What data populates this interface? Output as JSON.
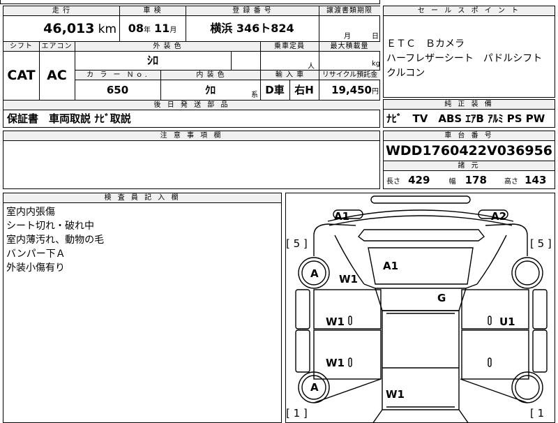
{
  "top_strip": {
    "partial_left": "",
    "partial_mid": ""
  },
  "mileage": {
    "header": "走 行",
    "value": "46,013",
    "unit": "km"
  },
  "inspection": {
    "header": "車 検",
    "year": "08",
    "year_unit": "年",
    "month": "11",
    "month_unit": "月"
  },
  "registration": {
    "header": "登 録 番 号",
    "value": "横浜 346ト824"
  },
  "transfer_deadline": {
    "header": "譲渡書類期限",
    "month_unit": "月",
    "day_unit": "日"
  },
  "shift": {
    "header": "シフト",
    "value": "CAT"
  },
  "aircon": {
    "header": "エアコン",
    "value": "AC"
  },
  "exterior_color": {
    "header": "外 装 色",
    "value": "ｼﾛ"
  },
  "capacity": {
    "header": "乗車定員",
    "unit": "人"
  },
  "max_load": {
    "header": "最大積載量",
    "unit": "kg"
  },
  "color_no": {
    "header": "カ ラ ー Ｎｏ.",
    "value": "650"
  },
  "interior_color": {
    "header": "内 装 色",
    "value": "ｸﾛ",
    "suffix": "系"
  },
  "import": {
    "header": "輸 入 車",
    "value1": "D車",
    "value2": "右H"
  },
  "recycle": {
    "header": "リサイクル預託金",
    "value": "19,450",
    "unit": "円"
  },
  "later_parts": {
    "header": "後 日 発 送 部 品",
    "value": "保証書　車両取説 ﾅﾋﾞ取説"
  },
  "notes": {
    "header": "注 意 事 項 欄",
    "value": ""
  },
  "sales_point": {
    "header": "セ ー ル ス ポ イ ン ト",
    "lines": [
      "ＥＴＣ　Ｂカメラ",
      "ハーフレザーシート　パドルシフト",
      "クルコン"
    ]
  },
  "equipment": {
    "header": "純 正 装 備",
    "value": "ﾅﾋﾞ　TV　ABS ｴｱB ｱﾙﾐ PS PW"
  },
  "chassis": {
    "header": "車 台 番 号",
    "value": "WDD1760422V036956"
  },
  "dimensions": {
    "header": "諸 元",
    "length_label": "長さ",
    "length": "429",
    "width_label": "幅",
    "width": "178",
    "height_label": "高さ",
    "height": "143"
  },
  "inspector": {
    "header": "検 査 員 記 入 欄",
    "lines": [
      "室内内張傷",
      "シート切れ・破れ中",
      "室内薄汚れ、動物の毛",
      "バンパー下Ａ",
      "外装小傷有り"
    ]
  },
  "diagram": {
    "a1_left": "A1",
    "a2_right": "A2",
    "bracket_tl": "[ 5 ]",
    "bracket_tr": "[ 5 ]",
    "bracket_bl": "[ 1 ]",
    "bracket_br": "[ 1",
    "hood": "A1",
    "front_left_fender": "W1",
    "front_left_wheel": "A",
    "roof": "G",
    "front_left_door": "W1",
    "front_right_door": "U1",
    "rear_left_door": "W1",
    "rear_left_wheel": "A",
    "trunk": "W1"
  }
}
